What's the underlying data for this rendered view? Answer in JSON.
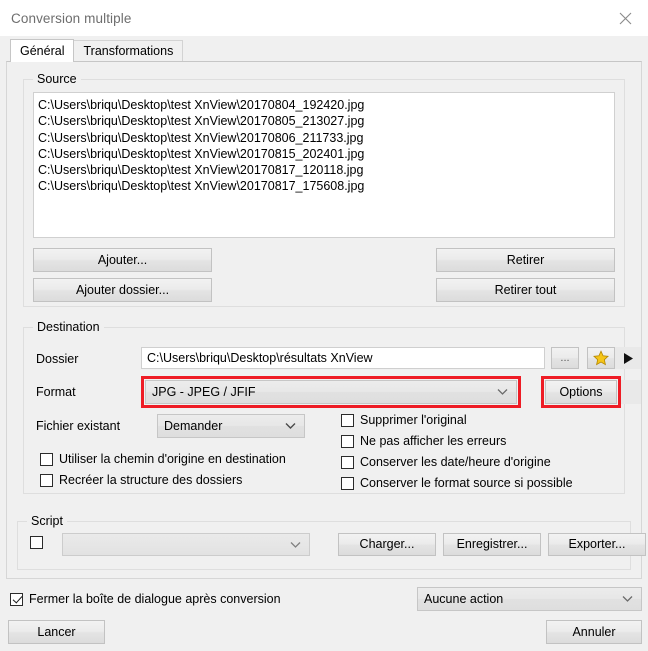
{
  "window": {
    "title": "Conversion multiple",
    "close_icon": "close-icon"
  },
  "tabs": [
    {
      "label": "Général",
      "active": true
    },
    {
      "label": "Transformations",
      "active": false
    }
  ],
  "source": {
    "group_title": "Source",
    "files": [
      "C:\\Users\\briqu\\Desktop\\test XnView\\20170804_192420.jpg",
      "C:\\Users\\briqu\\Desktop\\test XnView\\20170805_213027.jpg",
      "C:\\Users\\briqu\\Desktop\\test XnView\\20170806_211733.jpg",
      "C:\\Users\\briqu\\Desktop\\test XnView\\20170815_202401.jpg",
      "C:\\Users\\briqu\\Desktop\\test XnView\\20170817_120118.jpg",
      "C:\\Users\\briqu\\Desktop\\test XnView\\20170817_175608.jpg"
    ],
    "add_label": "Ajouter...",
    "add_folder_label": "Ajouter dossier...",
    "remove_label": "Retirer",
    "remove_all_label": "Retirer tout"
  },
  "destination": {
    "group_title": "Destination",
    "folder_label": "Dossier",
    "folder_value": "C:\\Users\\briqu\\Desktop\\résultats XnView",
    "browse_label": "...",
    "star_icon": "star-icon",
    "arrow_icon": "play-arrow-icon",
    "format_label": "Format",
    "format_value": "JPG - JPEG / JFIF",
    "options_label": "Options",
    "existing_file_label": "Fichier existant",
    "existing_file_value": "Demander",
    "checkboxes": [
      {
        "label": "Utiliser la chemin d'origine en destination",
        "checked": false
      },
      {
        "label": "Recréer la structure des dossiers",
        "checked": false
      },
      {
        "label": "Supprimer l'original",
        "checked": false
      },
      {
        "label": "Ne pas afficher les erreurs",
        "checked": false
      },
      {
        "label": "Conserver les date/heure d'origine",
        "checked": false
      },
      {
        "label": "Conserver le format source si possible",
        "checked": false
      }
    ]
  },
  "script": {
    "group_title": "Script",
    "enabled": false,
    "value": "",
    "load_label": "Charger...",
    "save_label": "Enregistrer...",
    "export_label": "Exporter..."
  },
  "footer": {
    "close_after_label": "Fermer la boîte de dialogue après conversion",
    "close_after_checked": true,
    "action_value": "Aucune action",
    "start_label": "Lancer",
    "cancel_label": "Annuler"
  },
  "annotations": {
    "highlight_color": "#ee1c25",
    "highlighted": [
      "format-combobox",
      "options-button"
    ]
  }
}
